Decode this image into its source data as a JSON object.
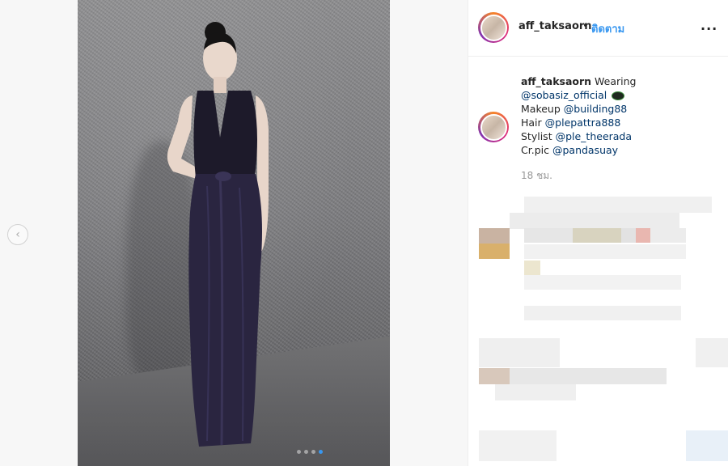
{
  "post": {
    "username": "aff_taksaorn",
    "bullet": "•",
    "follow_label": "ติดตาม",
    "more_icon": "...",
    "prev_icon": "‹",
    "carousel": {
      "count": 4,
      "active_index": 3
    }
  },
  "caption": {
    "username": "aff_taksaorn",
    "text_after_user": "Wearing",
    "mention_brand": "@sobasiz_official",
    "makeup_label": "Makeup",
    "mention_makeup": "@building88",
    "hair_label": "Hair",
    "mention_hair": "@plepattra888",
    "stylist_label": "Stylist",
    "mention_stylist": "@ple_theerada",
    "credit_label": "Cr.pic",
    "mention_credit": "@pandasuay",
    "timestamp": "18 ชม."
  },
  "colors": {
    "accent": "#3897f0",
    "mention": "#003569",
    "muted": "#999999"
  }
}
